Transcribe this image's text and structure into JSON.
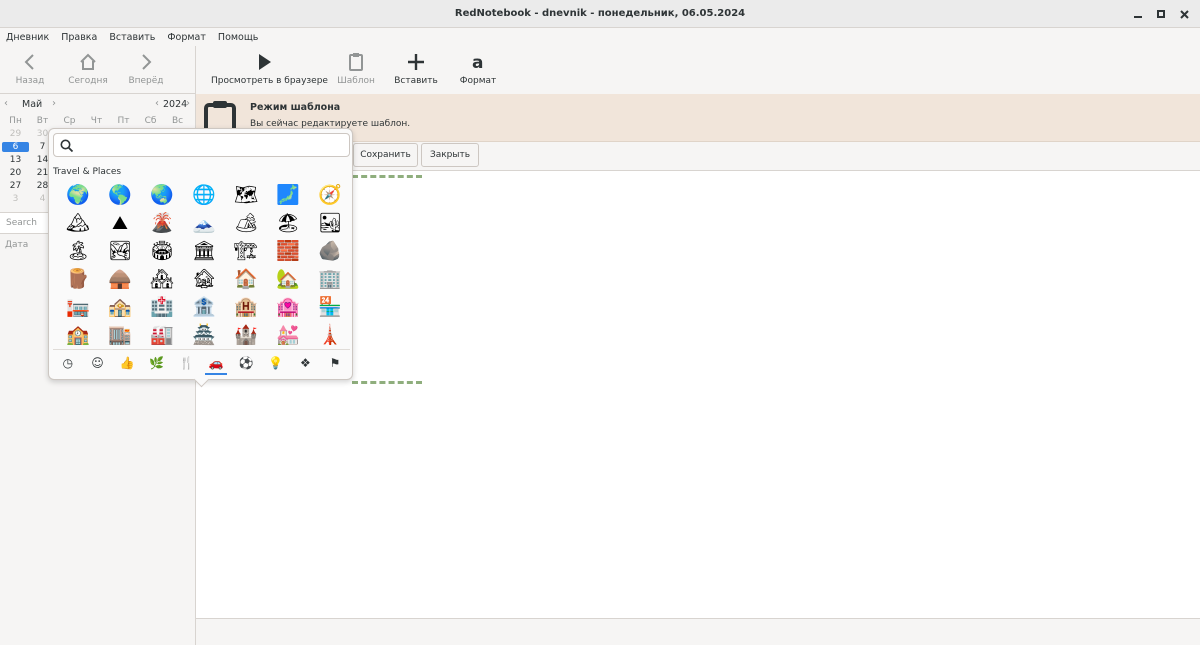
{
  "window": {
    "title": "RedNotebook - dnevnik - понедельник, 06.05.2024"
  },
  "menu": [
    "Дневник",
    "Правка",
    "Вставить",
    "Формат",
    "Помощь"
  ],
  "nav": {
    "back": "Назад",
    "today": "Сегодня",
    "forward": "Вперёд"
  },
  "calendar": {
    "month": "Май",
    "year": "2024",
    "weekdays": [
      "Пн",
      "Вт",
      "Ср",
      "Чт",
      "Пт",
      "Сб",
      "Вс"
    ],
    "rows": [
      [
        "29",
        "30",
        "",
        "",
        "",
        "",
        ""
      ],
      [
        "6",
        "7",
        "",
        "",
        "",
        "",
        ""
      ],
      [
        "13",
        "14",
        "",
        "",
        "",
        "",
        ""
      ],
      [
        "20",
        "21",
        "",
        "",
        "",
        "",
        ""
      ],
      [
        "27",
        "28",
        "",
        "",
        "",
        "",
        ""
      ],
      [
        "3",
        "4",
        "",
        "",
        "",
        "",
        ""
      ]
    ],
    "selected_day": "6"
  },
  "search": {
    "placeholder": "Search"
  },
  "list": {
    "column_header": "Дата"
  },
  "toolbar": {
    "preview": "Просмотреть в браузере",
    "template": "Шаблон",
    "insert": "Вставить",
    "format": "Формат"
  },
  "infobar": {
    "title": "Режим шаблона",
    "message": "Вы сейчас редактируете шаблон."
  },
  "buttons": {
    "save": "Сохранить",
    "close": "Закрыть"
  },
  "emoji_picker": {
    "search_value": "",
    "section_title": "Travel & Places",
    "emojis": [
      "🌍",
      "🌎",
      "🌏",
      "🌐",
      "🗺",
      "🗾",
      "🧭",
      "🏔",
      "⛰",
      "🌋",
      "🗻",
      "🏕",
      "🏖",
      "🏜",
      "🏝",
      "🏞",
      "🏟",
      "🏛",
      "🏗",
      "🧱",
      "🪨",
      "🪵",
      "🛖",
      "🏘",
      "🏚",
      "🏠",
      "🏡",
      "🏢",
      "🏣",
      "🏤",
      "🏥",
      "🏦",
      "🏨",
      "🏩",
      "🏪",
      "🏫",
      "🏬",
      "🏭",
      "🏯",
      "🏰",
      "💒",
      "🗼"
    ],
    "categories": [
      {
        "icon": "recent-icon",
        "glyph": "◷"
      },
      {
        "icon": "smiley-icon",
        "glyph": "☺"
      },
      {
        "icon": "thumbs-up-icon",
        "glyph": "👍"
      },
      {
        "icon": "nature-icon",
        "glyph": "🌿"
      },
      {
        "icon": "food-icon",
        "glyph": "🍴"
      },
      {
        "icon": "car-icon",
        "glyph": "🚗"
      },
      {
        "icon": "activities-icon",
        "glyph": "⚽"
      },
      {
        "icon": "objects-icon",
        "glyph": "💡"
      },
      {
        "icon": "symbols-icon",
        "glyph": "❖"
      },
      {
        "icon": "flag-icon",
        "glyph": "⚑"
      }
    ],
    "active_category": 5
  }
}
